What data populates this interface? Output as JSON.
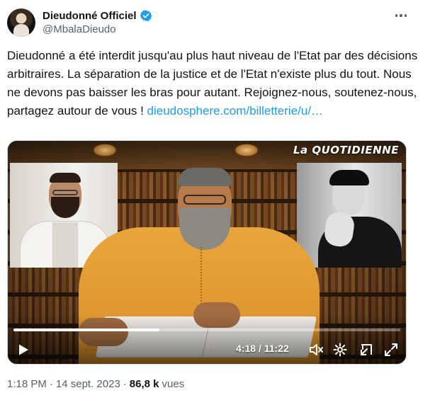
{
  "author": {
    "display_name": "Dieudonné Officiel",
    "handle": "@MbalaDieudo",
    "verified": true,
    "avatar_icon": "avatar-image"
  },
  "tweet": {
    "text": "Dieudonné a été interdit jusqu'au plus haut niveau de l'Etat par des décisions arbitraires. La séparation de la justice et de l'Etat n'existe plus du tout. Nous ne devons pas baisser les bras pour autant. Rejoignez-nous, soutenez-nous, partagez autour de vous ! ",
    "link": "dieudosphere.com/billetterie/u/…"
  },
  "video": {
    "watermark": "La QUOTIDIENNE",
    "current_time": "4:18",
    "duration": "11:22",
    "time_display": "4:18 / 11:22",
    "progress_fraction": 0.378
  },
  "meta": {
    "time": "1:18 PM",
    "sep1": "·",
    "date": "14 sept. 2023",
    "sep2": "·",
    "views_count": "86,8 k",
    "views_label": "vues"
  },
  "colors": {
    "link": "#1d9bf0",
    "verified": "#1d9bf0",
    "muted_text": "#536471"
  }
}
